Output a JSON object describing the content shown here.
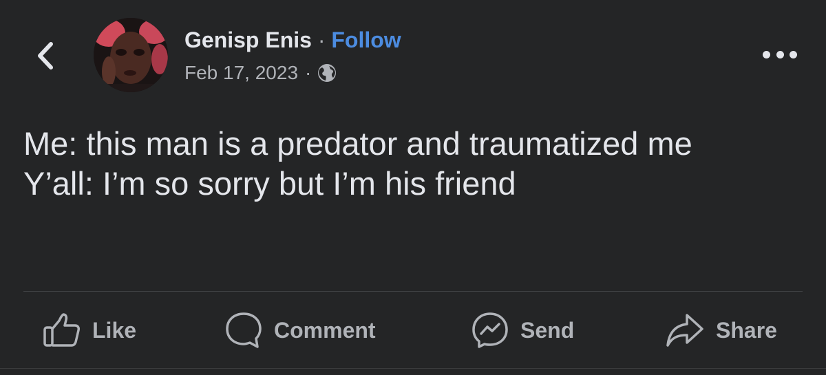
{
  "header": {
    "back_icon": "chevron-left-icon",
    "author_name": "Genisp Enis",
    "separator": "·",
    "follow_label": "Follow",
    "post_date": "Feb 17, 2023",
    "audience_icon": "globe-icon",
    "more_icon": "more-horizontal-icon"
  },
  "post": {
    "lines": [
      "Me: this man is a predator and traumatized me",
      "Y’all: I’m so sorry but I’m his friend"
    ]
  },
  "actions": {
    "like_label": "Like",
    "comment_label": "Comment",
    "send_label": "Send",
    "share_label": "Share"
  },
  "colors": {
    "background": "#242526",
    "text_primary": "#e4e6eb",
    "text_secondary": "#b0b3b8",
    "follow_link": "#4c8ce0"
  }
}
